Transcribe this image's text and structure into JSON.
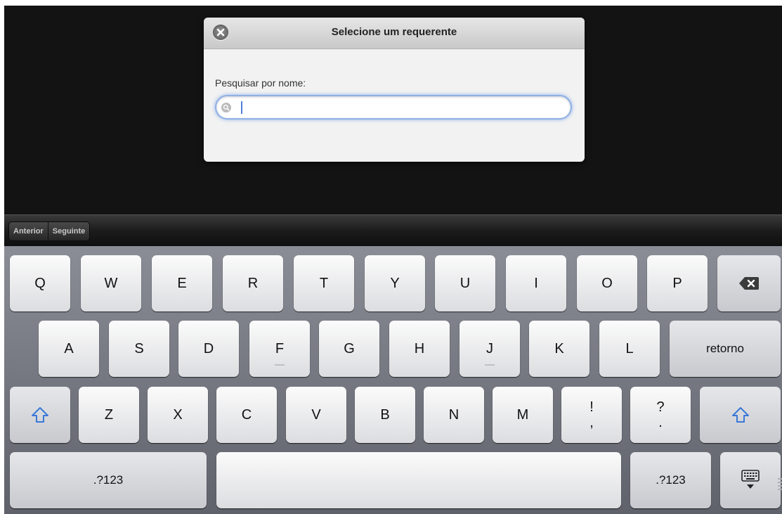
{
  "dialog": {
    "title": "Selecione um requerente",
    "close_icon": "close-circle-icon",
    "search_label": "Pesquisar por nome:",
    "search_value": "",
    "search_placeholder": "",
    "search_icon": "magnifier-icon"
  },
  "toolbar": {
    "previous_label": "Anterior",
    "next_label": "Seguinte"
  },
  "keyboard": {
    "row1": [
      "Q",
      "W",
      "E",
      "R",
      "T",
      "Y",
      "U",
      "I",
      "O",
      "P"
    ],
    "backspace_icon": "backspace-icon",
    "row2": [
      "A",
      "S",
      "D",
      "F",
      "G",
      "H",
      "J",
      "K",
      "L"
    ],
    "return_label": "retorno",
    "row3": [
      "Z",
      "X",
      "C",
      "V",
      "B",
      "N",
      "M"
    ],
    "shift_icon": "shift-arrow-icon",
    "exclaim_top": "!",
    "exclaim_bottom": ",",
    "question_top": "?",
    "question_bottom": ".",
    "numbers_label": ".?123",
    "space_label": "",
    "hide_keyboard_icon": "keyboard-dismiss-icon"
  },
  "colors": {
    "accent_blue": "#3a78d8",
    "screen_bg": "#131313",
    "keyboard_bg": "#767982"
  }
}
